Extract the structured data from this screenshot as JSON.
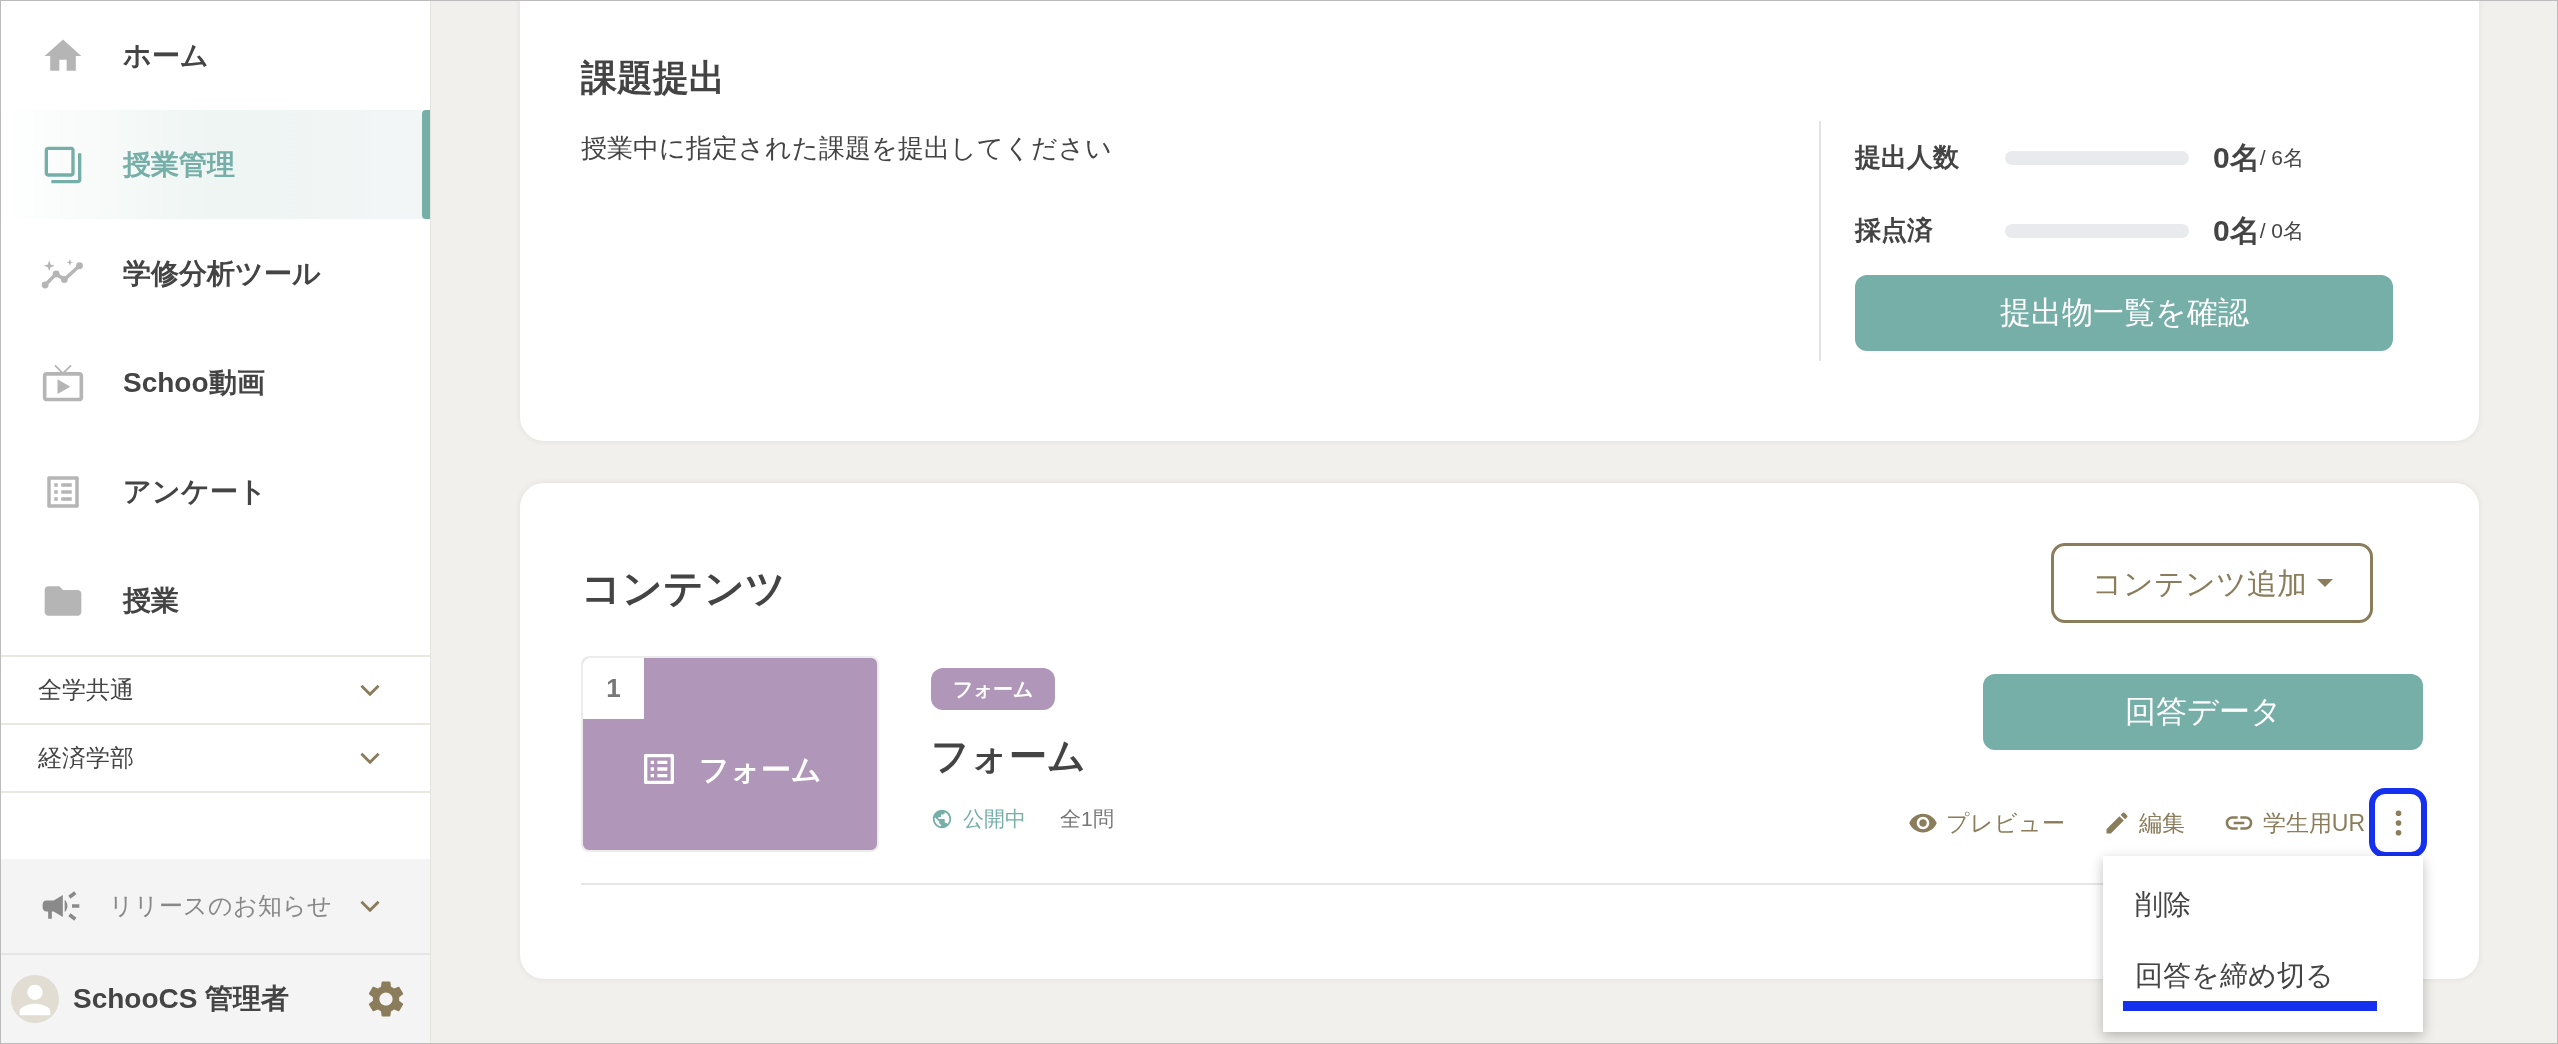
{
  "sidebar": {
    "nav_items": [
      {
        "label": "ホーム",
        "selected": false
      },
      {
        "label": "授業管理",
        "selected": true
      },
      {
        "label": "学修分析ツール",
        "selected": false
      },
      {
        "label": "Schoo動画",
        "selected": false
      },
      {
        "label": "アンケート",
        "selected": false
      },
      {
        "label": "授業",
        "selected": false
      }
    ],
    "groups": [
      {
        "label": "全学共通",
        "expanded": false
      },
      {
        "label": "経済学部",
        "expanded": false
      }
    ],
    "release": {
      "label": "リリースのお知らせ",
      "expanded": false
    },
    "user": {
      "name": "SchooCS 管理者"
    }
  },
  "assignment": {
    "title": "課題提出",
    "description": "授業中に指定された課題を提出してください",
    "stats": [
      {
        "label": "提出人数",
        "level": 0,
        "value": "0名",
        "total": "/ 6名"
      },
      {
        "label": "採点済",
        "level": 0,
        "value": "0名",
        "total": "/ 0名"
      }
    ],
    "button": "提出物一覧を確認"
  },
  "contents": {
    "title": "コンテンツ",
    "add_button": "コンテンツ追加",
    "items": [
      {
        "number": "1",
        "thumbnail_label": "フォーム",
        "tag": "フォーム",
        "title": "フォーム",
        "status": "公開中",
        "question_count": "全1問",
        "primary_button": "回答データ",
        "actions": [
          {
            "label": "プレビュー"
          },
          {
            "label": "編集"
          },
          {
            "label": "学生用UR"
          }
        ],
        "more_highlighted": true,
        "menu": {
          "open": true,
          "items": [
            {
              "label": "削除",
              "marked": false
            },
            {
              "label": "回答を締め切る",
              "marked": true
            }
          ]
        }
      }
    ]
  }
}
